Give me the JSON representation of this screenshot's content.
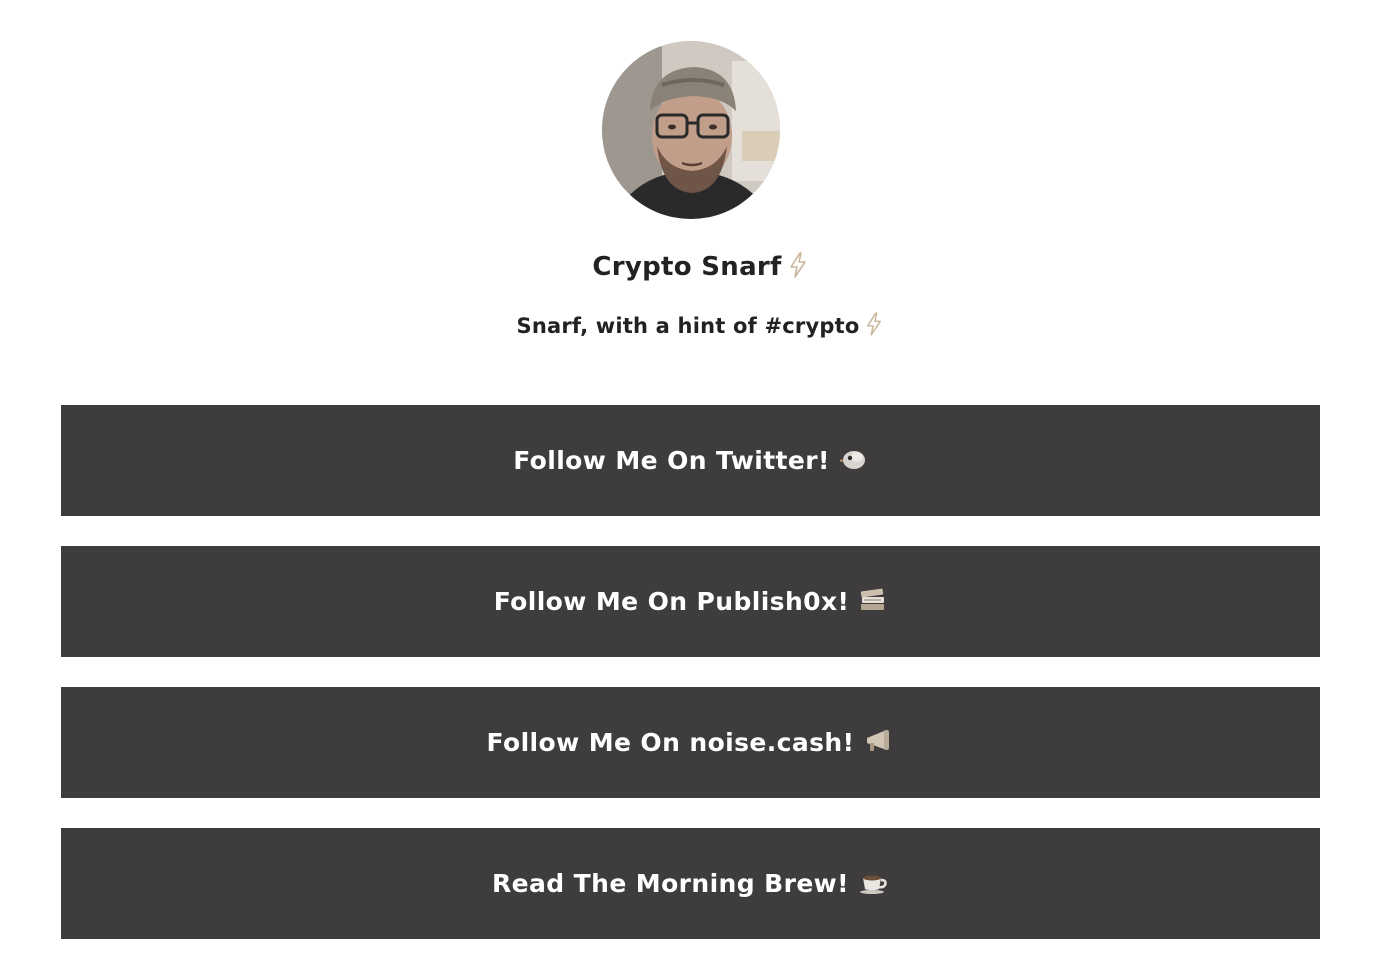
{
  "profile": {
    "name": "Crypto Snarf",
    "bio": "Snarf, with a hint of #crypto",
    "accent_bolt_color": "#c9b59a"
  },
  "links": [
    {
      "label": "Follow Me On Twitter!",
      "icon": "bird-icon"
    },
    {
      "label": "Follow Me On Publish0x!",
      "icon": "books-icon"
    },
    {
      "label": "Follow Me On noise.cash!",
      "icon": "megaphone-icon"
    },
    {
      "label": "Read The Morning Brew!",
      "icon": "coffee-icon"
    }
  ],
  "colors": {
    "background": "#ffffff",
    "button": "#3e3c3d",
    "button_text": "#ffffff",
    "text": "#222222"
  }
}
